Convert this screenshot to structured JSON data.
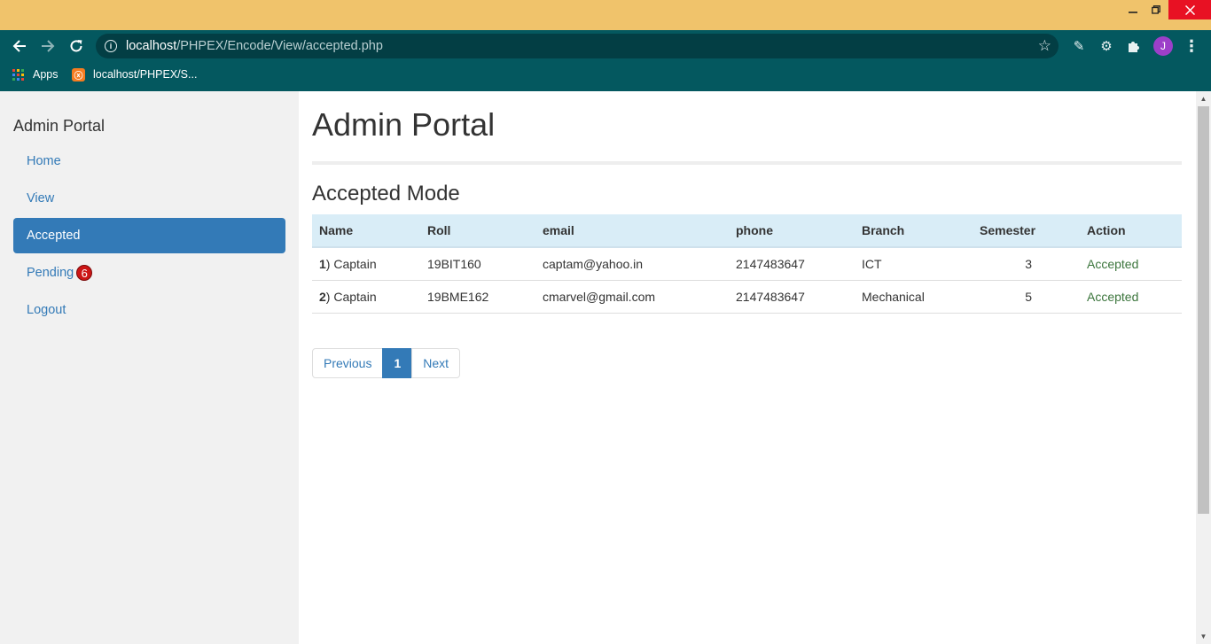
{
  "browser": {
    "url_host": "localhost",
    "url_path": "/PHPEX/Encode/View/accepted.php",
    "avatar_letter": "J",
    "bookmarks": [
      {
        "label": "Apps",
        "icon": "apps-grid-icon"
      },
      {
        "label": "localhost/PHPEX/S...",
        "icon": "xampp-icon"
      }
    ],
    "xampp_glyph": "ⓧ"
  },
  "sidebar": {
    "brand": "Admin Portal",
    "items": [
      {
        "label": "Home",
        "active": false
      },
      {
        "label": "View",
        "active": false
      },
      {
        "label": "Accepted",
        "active": true
      },
      {
        "label": "Pending",
        "active": false,
        "badge": "6"
      },
      {
        "label": "Logout",
        "active": false
      }
    ]
  },
  "main": {
    "title": "Admin Portal",
    "section_title": "Accepted Mode",
    "table": {
      "headers": [
        "Name",
        "Roll",
        "email",
        "phone",
        "Branch",
        "Semester",
        "Action"
      ],
      "rows": [
        {
          "index": "1",
          "name": ") Captain",
          "roll": "19BIT160",
          "email": "captam@yahoo.in",
          "phone": "2147483647",
          "branch": "ICT",
          "semester": "3",
          "action": "Accepted"
        },
        {
          "index": "2",
          "name": ") Captain",
          "roll": "19BME162",
          "email": "cmarvel@gmail.com",
          "phone": "2147483647",
          "branch": "Mechanical",
          "semester": "5",
          "action": "Accepted"
        }
      ]
    },
    "pagination": {
      "previous": "Previous",
      "current": "1",
      "next": "Next"
    }
  },
  "colors": {
    "accent": "#337ab7",
    "accepted_text": "#3c763d",
    "table_header": "#d9edf7",
    "browser_chrome": "#04585f",
    "title_strip": "#f0c36b",
    "badge": "#cc1616"
  }
}
